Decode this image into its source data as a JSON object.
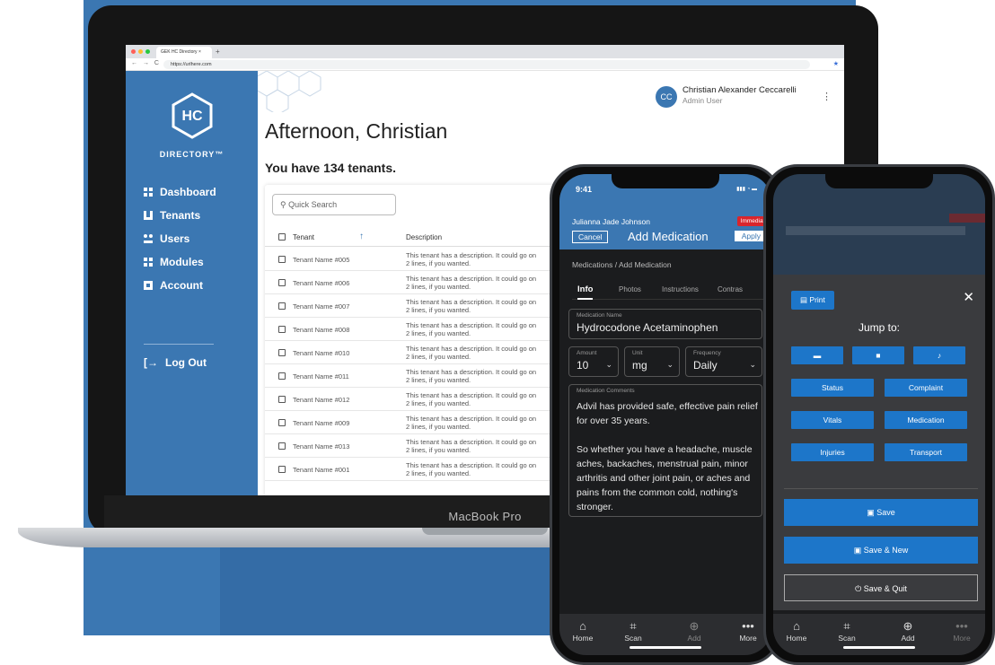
{
  "browser": {
    "tab_title": "GEK HC Directory",
    "tab_close": "×",
    "new_tab": "+",
    "nav": "← → C",
    "url": "https://urlhere.com",
    "star": "★"
  },
  "sidebar": {
    "logo_text": "HC",
    "brand": "DIRECTORY™",
    "items": [
      {
        "label": "Dashboard",
        "icon": "grid-icon"
      },
      {
        "label": "Tenants",
        "icon": "building-icon"
      },
      {
        "label": "Users",
        "icon": "users-icon"
      },
      {
        "label": "Modules",
        "icon": "modules-icon"
      },
      {
        "label": "Account",
        "icon": "account-icon"
      }
    ],
    "logout": "Log Out"
  },
  "header": {
    "avatar_initials": "CC",
    "user_name": "Christian Alexander Ceccarelli",
    "user_role": "Admin User",
    "menu": "⋮"
  },
  "main": {
    "greeting": "Afternoon, Christian",
    "tenant_count": "You have 134 tenants.",
    "search_placeholder": "Quick Search",
    "col_tenant": "Tenant",
    "sort_arrow": "↑",
    "col_description": "Description",
    "rows": [
      {
        "name": "Tenant Name #005",
        "desc": "This tenant has a description. It could go on 2 lines, if you wanted."
      },
      {
        "name": "Tenant Name #006",
        "desc": "This tenant has a description. It could go on 2 lines, if you wanted."
      },
      {
        "name": "Tenant Name #007",
        "desc": "This tenant has a description. It could go on 2 lines, if you wanted."
      },
      {
        "name": "Tenant Name #008",
        "desc": "This tenant has a description. It could go on 2 lines, if you wanted."
      },
      {
        "name": "Tenant Name #010",
        "desc": "This tenant has a description. It could go on 2 lines, if you wanted."
      },
      {
        "name": "Tenant Name #011",
        "desc": "This tenant has a description. It could go on 2 lines, if you wanted."
      },
      {
        "name": "Tenant Name #012",
        "desc": "This tenant has a description. It could go on 2 lines, if you wanted."
      },
      {
        "name": "Tenant Name #009",
        "desc": "This tenant has a description. It could go on 2 lines, if you wanted."
      },
      {
        "name": "Tenant Name #013",
        "desc": "This tenant has a description. It could go on 2 lines, if you wanted."
      },
      {
        "name": "Tenant Name #001",
        "desc": "This tenant has a description. It could go on 2 lines, if you wanted."
      }
    ]
  },
  "laptop_model": "MacBook Pro",
  "phone1": {
    "time": "9:41",
    "patient": "Julianna Jade Johnson",
    "priority": "Immediate",
    "cancel": "Cancel",
    "title": "Add Medication",
    "apply": "Apply",
    "breadcrumb": "Medications / Add Medication",
    "tabs": [
      "Info",
      "Photos",
      "Instructions",
      "Contras"
    ],
    "med_name_label": "Medication Name",
    "med_name": "Hydrocodone Acetaminophen",
    "amount_label": "Amount",
    "amount": "10",
    "unit_label": "Unit",
    "unit": "mg",
    "freq_label": "Frequency",
    "freq": "Daily",
    "comments_label": "Medication Comments",
    "comments_p1": "Advil has provided safe, effective pain relief for over 35 years.",
    "comments_p2": "So whether you have a headache, muscle aches, backaches, menstrual pain, minor arthritis and other joint pain, or aches and pains from the common cold, nothing's stronger.",
    "tabbar": [
      {
        "label": "Home",
        "icon": "⌂"
      },
      {
        "label": "Scan",
        "icon": "⌗"
      },
      {
        "label": "Add",
        "icon": "⊕"
      },
      {
        "label": "More",
        "icon": "•••"
      }
    ]
  },
  "phone2": {
    "print": "Print",
    "close": "✕",
    "jump_to": "Jump to:",
    "media_buttons": [
      "▬",
      "■",
      "♪"
    ],
    "buttons": [
      "Status",
      "Complaint",
      "Vitals",
      "Medication",
      "Injuries",
      "Transport"
    ],
    "save": "Save",
    "save_new": "Save & New",
    "save_quit": "Save & Quit",
    "tabbar": [
      {
        "label": "Home",
        "icon": "⌂"
      },
      {
        "label": "Scan",
        "icon": "⌗"
      },
      {
        "label": "Add",
        "icon": "⊕"
      },
      {
        "label": "More",
        "icon": "•••"
      }
    ]
  },
  "colors": {
    "brand_blue": "#3b77b2",
    "button_blue": "#1d76c9",
    "danger": "#d9252c"
  }
}
